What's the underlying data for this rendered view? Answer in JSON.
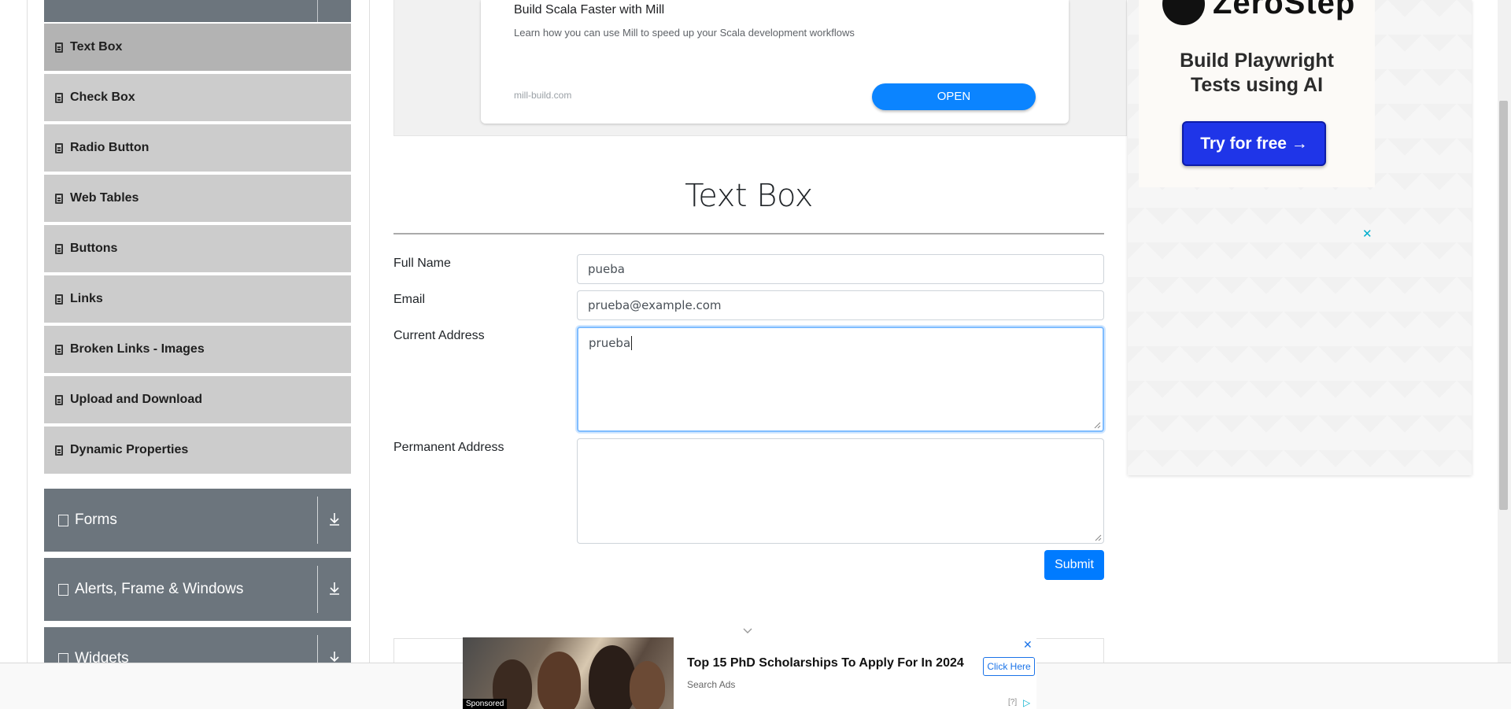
{
  "sidebar": {
    "items": [
      {
        "label": "Text Box"
      },
      {
        "label": "Check Box"
      },
      {
        "label": "Radio Button"
      },
      {
        "label": "Web Tables"
      },
      {
        "label": "Buttons"
      },
      {
        "label": "Links"
      },
      {
        "label": "Broken Links - Images"
      },
      {
        "label": "Upload and Download"
      },
      {
        "label": "Dynamic Properties"
      }
    ],
    "groups": [
      {
        "label": "Forms"
      },
      {
        "label": "Alerts, Frame & Windows"
      },
      {
        "label": "Widgets"
      }
    ]
  },
  "ad_top": {
    "title": "Build Scala Faster with Mill",
    "description": "Learn how you can use Mill to speed up your Scala development workflows",
    "domain": "mill-build.com",
    "cta": "OPEN"
  },
  "form": {
    "title": "Text Box",
    "full_name_label": "Full Name",
    "full_name_value": "pueba",
    "email_label": "Email",
    "email_value": "prueba@example.com",
    "current_address_label": "Current Address",
    "current_address_value": "prueba",
    "permanent_address_label": "Permanent Address",
    "permanent_address_value": "",
    "submit_label": "Submit"
  },
  "ad_right": {
    "brand": "ZeroStep",
    "headline_line1": "Build Playwright",
    "headline_line2": "Tests using AI",
    "cta": "Try for free →",
    "close": "✕"
  },
  "ad_bottom": {
    "title": "Top 15 PhD Scholarships To Apply For In 2024",
    "source": "Search Ads",
    "cta": "Click Here",
    "sponsored": "Sponsored",
    "close": "✕",
    "info": "[?]"
  },
  "colors": {
    "accent": "#007bff",
    "sidebar_group": "#6c757d",
    "sidebar_item": "#cccccc",
    "sidebar_active": "#b3b3b3",
    "zerostep_cta": "#1f35e8"
  }
}
